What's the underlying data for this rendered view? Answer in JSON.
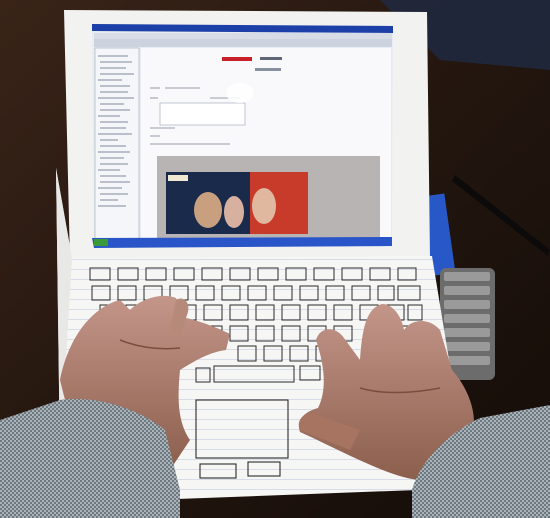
{
  "photo": {
    "subject": "paper-laptop-with-printed-screen-and-hand-drawn-keyboard",
    "colors": {
      "table": "#2a1b14",
      "paper": "#f4f4f2",
      "screen_title": "#1c3fa8",
      "taskbar": "#2a55c8",
      "skin": "#b07f6c",
      "sleeve": "#8f9aa0",
      "ink": "#2b2b2b"
    }
  },
  "screen": {
    "heading_red": "#c8202a",
    "video_panel_color": "#b8b4b4"
  },
  "keyboard": {
    "function_row_keys": 12,
    "row_key_counts": [
      13,
      13,
      12,
      11
    ],
    "ink_line_color": "#9aa6c8"
  }
}
